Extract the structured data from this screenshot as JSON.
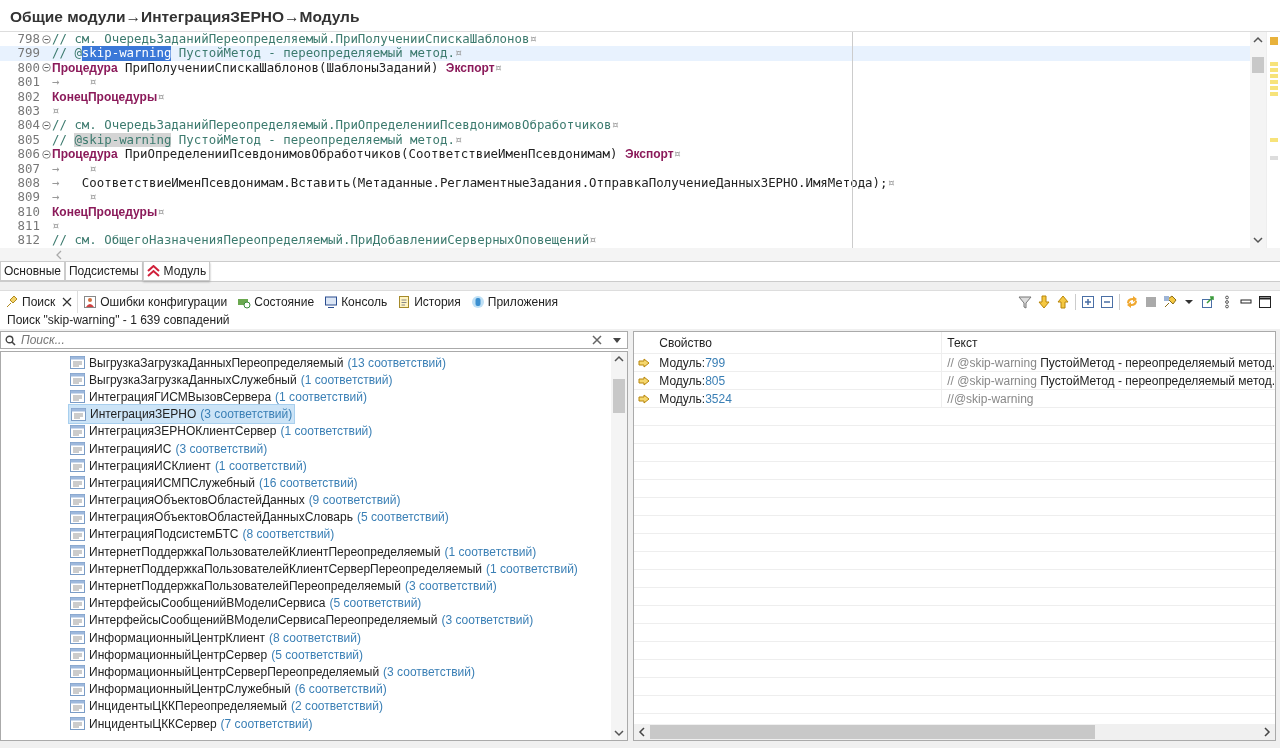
{
  "window": {
    "title": "Общие модули→ИнтеграцияЗЕРНО→Модуль"
  },
  "editor": {
    "lines": [
      {
        "number": "798",
        "foldable": true,
        "current": false,
        "tokens": [
          {
            "kind": "comment",
            "text": "// см. ОчередьЗаданийПереопределяемый.ПриПолученииСпискаШаблонов"
          },
          {
            "kind": "eol",
            "text": "¤"
          }
        ]
      },
      {
        "number": "799",
        "foldable": false,
        "current": true,
        "tokens": [
          {
            "kind": "comment",
            "text": "// @"
          },
          {
            "kind": "selection",
            "text": "skip-warning"
          },
          {
            "kind": "comment",
            "text": " ПустойМетод - переопределяемый метод."
          },
          {
            "kind": "eol",
            "text": "¤"
          }
        ]
      },
      {
        "number": "800",
        "foldable": true,
        "current": false,
        "tokens": [
          {
            "kind": "keyword",
            "text": "Процедура"
          },
          {
            "kind": "plain",
            "text": " ПриПолученииСпискаШаблонов(ШаблоныЗаданий) "
          },
          {
            "kind": "keyword",
            "text": "Экспорт"
          },
          {
            "kind": "eol",
            "text": "¤"
          }
        ]
      },
      {
        "number": "801",
        "foldable": false,
        "current": false,
        "tokens": [
          {
            "kind": "eol",
            "text": "→    ¤"
          }
        ]
      },
      {
        "number": "802",
        "foldable": false,
        "current": false,
        "tokens": [
          {
            "kind": "keyword",
            "text": "КонецПроцедуры"
          },
          {
            "kind": "eol",
            "text": "¤"
          }
        ]
      },
      {
        "number": "803",
        "foldable": false,
        "current": false,
        "tokens": [
          {
            "kind": "eol",
            "text": "¤"
          }
        ]
      },
      {
        "number": "804",
        "foldable": true,
        "current": false,
        "tokens": [
          {
            "kind": "comment",
            "text": "// см. ОчередьЗаданийПереопределяемый.ПриОпределенииПсевдонимовОбработчиков"
          },
          {
            "kind": "eol",
            "text": "¤"
          }
        ]
      },
      {
        "number": "805",
        "foldable": false,
        "current": false,
        "tokens": [
          {
            "kind": "comment",
            "text": "// "
          },
          {
            "kind": "occurrence",
            "text": "@skip-warning"
          },
          {
            "kind": "comment",
            "text": " ПустойМетод - переопределяемый метод."
          },
          {
            "kind": "eol",
            "text": "¤"
          }
        ]
      },
      {
        "number": "806",
        "foldable": true,
        "current": false,
        "tokens": [
          {
            "kind": "keyword",
            "text": "Процедура"
          },
          {
            "kind": "plain",
            "text": " ПриОпределенииПсевдонимовОбработчиков(СоответствиеИменПсевдонимам) "
          },
          {
            "kind": "keyword",
            "text": "Экспорт"
          },
          {
            "kind": "eol",
            "text": "¤"
          }
        ]
      },
      {
        "number": "807",
        "foldable": false,
        "current": false,
        "tokens": [
          {
            "kind": "eol",
            "text": "→    ¤"
          }
        ]
      },
      {
        "number": "808",
        "foldable": false,
        "current": false,
        "tokens": [
          {
            "kind": "eol",
            "text": "→ "
          },
          {
            "kind": "plain",
            "text": "  СоответствиеИменПсевдонимам.Вставить(Метаданные.РегламентныеЗадания.ОтправкаПолучениеДанныхЗЕРНО.ИмяМетода);"
          },
          {
            "kind": "eol",
            "text": "¤"
          }
        ]
      },
      {
        "number": "809",
        "foldable": false,
        "current": false,
        "tokens": [
          {
            "kind": "eol",
            "text": "→    ¤"
          }
        ]
      },
      {
        "number": "810",
        "foldable": false,
        "current": false,
        "tokens": [
          {
            "kind": "keyword",
            "text": "КонецПроцедуры"
          },
          {
            "kind": "eol",
            "text": "¤"
          }
        ]
      },
      {
        "number": "811",
        "foldable": false,
        "current": false,
        "tokens": [
          {
            "kind": "eol",
            "text": "¤"
          }
        ]
      },
      {
        "number": "812",
        "foldable": false,
        "current": false,
        "tokens": [
          {
            "kind": "comment",
            "text": "// см. ОбщегоНазначенияПереопределяемый.ПриДобавленииСерверныхОповещений"
          },
          {
            "kind": "eol",
            "text": "¤"
          }
        ]
      }
    ]
  },
  "editor_tabs": [
    {
      "label": "Основные",
      "selected": false,
      "icon": false
    },
    {
      "label": "Подсистемы",
      "selected": false,
      "icon": false
    },
    {
      "label": "Модуль",
      "selected": true,
      "icon": true
    }
  ],
  "view_tabs": [
    {
      "label": "Поиск",
      "selected": true,
      "kind": "search"
    },
    {
      "label": "Ошибки конфигурации",
      "selected": false,
      "kind": "errors"
    },
    {
      "label": "Состояние",
      "selected": false,
      "kind": "state"
    },
    {
      "label": "Консоль",
      "selected": false,
      "kind": "console"
    },
    {
      "label": "История",
      "selected": false,
      "kind": "history"
    },
    {
      "label": "Приложения",
      "selected": false,
      "kind": "apps"
    }
  ],
  "search_summary": "Поиск \"skip-warning\" - 1 639 совпадений",
  "filter": {
    "placeholder": "Поиск..."
  },
  "tree": {
    "items": [
      {
        "name": "ВыгрузкаЗагрузкаДанныхПереопределяемый",
        "count": "(13 соответствий)",
        "selected": false
      },
      {
        "name": "ВыгрузкаЗагрузкаДанныхСлужебный",
        "count": "(1 соответствий)",
        "selected": false
      },
      {
        "name": "ИнтеграцияГИСМВызовСервера",
        "count": "(1 соответствий)",
        "selected": false
      },
      {
        "name": "ИнтеграцияЗЕРНО",
        "count": "(3 соответствий)",
        "selected": true
      },
      {
        "name": "ИнтеграцияЗЕРНОКлиентСервер",
        "count": "(1 соответствий)",
        "selected": false
      },
      {
        "name": "ИнтеграцияИС",
        "count": "(3 соответствий)",
        "selected": false
      },
      {
        "name": "ИнтеграцияИСКлиент",
        "count": "(1 соответствий)",
        "selected": false
      },
      {
        "name": "ИнтеграцияИСМПСлужебный",
        "count": "(16 соответствий)",
        "selected": false
      },
      {
        "name": "ИнтеграцияОбъектовОбластейДанных",
        "count": "(9 соответствий)",
        "selected": false
      },
      {
        "name": "ИнтеграцияОбъектовОбластейДанныхСловарь",
        "count": "(5 соответствий)",
        "selected": false
      },
      {
        "name": "ИнтеграцияПодсистемБТС",
        "count": "(8 соответствий)",
        "selected": false
      },
      {
        "name": "ИнтернетПоддержкаПользователейКлиентПереопределяемый",
        "count": "(1 соответствий)",
        "selected": false
      },
      {
        "name": "ИнтернетПоддержкаПользователейКлиентСерверПереопределяемый",
        "count": "(1 соответствий)",
        "selected": false
      },
      {
        "name": "ИнтернетПоддержкаПользователейПереопределяемый",
        "count": "(3 соответствий)",
        "selected": false
      },
      {
        "name": "ИнтерфейсыСообщенийВМоделиСервиса",
        "count": "(5 соответствий)",
        "selected": false
      },
      {
        "name": "ИнтерфейсыСообщенийВМоделиСервисаПереопределяемый",
        "count": "(3 соответствий)",
        "selected": false
      },
      {
        "name": "ИнформационныйЦентрКлиент",
        "count": "(8 соответствий)",
        "selected": false
      },
      {
        "name": "ИнформационныйЦентрСервер",
        "count": "(5 соответствий)",
        "selected": false
      },
      {
        "name": "ИнформационныйЦентрСерверПереопределяемый",
        "count": "(3 соответствий)",
        "selected": false
      },
      {
        "name": "ИнформационныйЦентрСлужебный",
        "count": "(6 соответствий)",
        "selected": false
      },
      {
        "name": "ИнцидентыЦККПереопределяемый",
        "count": "(2 соответствий)",
        "selected": false
      },
      {
        "name": "ИнцидентыЦККСервер",
        "count": "(7 соответствий)",
        "selected": false
      }
    ]
  },
  "results": {
    "columns": [
      "Свойство",
      "Текст"
    ],
    "rows": [
      {
        "module": "Модуль:",
        "line": "799",
        "marker": "// @skip-warning",
        "text": "ПустойМетод - переопределяемый метод."
      },
      {
        "module": "Модуль:",
        "line": "805",
        "marker": "// @skip-warning",
        "text": "ПустойМетод - переопределяемый метод."
      },
      {
        "module": "Модуль:",
        "line": "3524",
        "marker": "//@skip-warning"
      }
    ]
  }
}
